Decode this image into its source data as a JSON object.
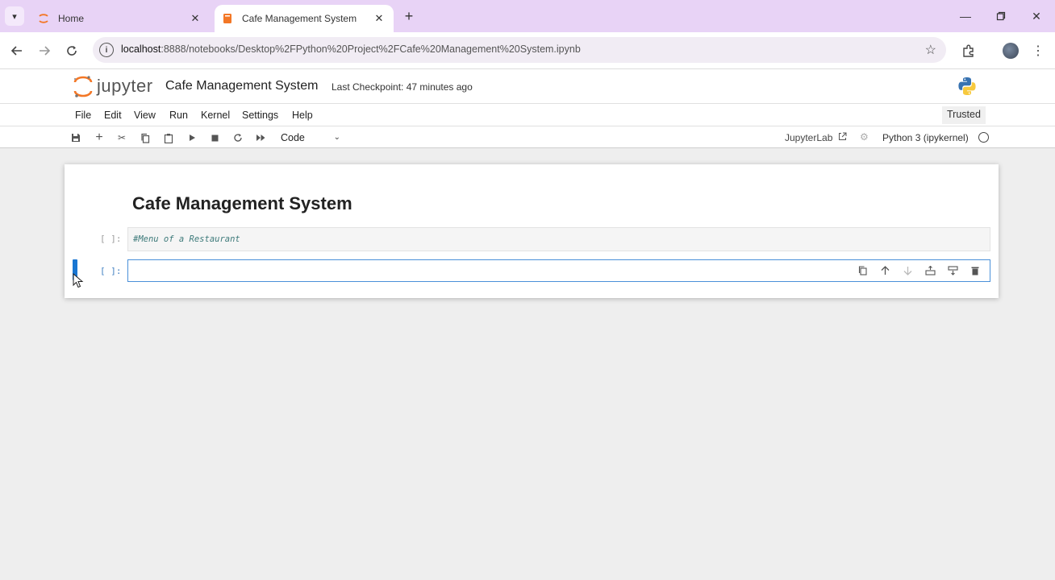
{
  "browser": {
    "tabs": [
      {
        "label": "Home",
        "icon": "jupyter-favicon",
        "active": false
      },
      {
        "label": "Cafe Management System",
        "icon": "notebook-favicon",
        "active": true
      }
    ],
    "new_tab": "+",
    "url_host": "localhost",
    "url_rest": ":8888/notebooks/Desktop%2FPython%20Project%2FCafe%20Management%20System.ipynb"
  },
  "jupyter": {
    "logo_text": "jupyter",
    "notebook_title": "Cafe Management System",
    "checkpoint": "Last Checkpoint: 47 minutes ago"
  },
  "menu": {
    "items": [
      "File",
      "Edit",
      "View",
      "Run",
      "Kernel",
      "Settings",
      "Help"
    ],
    "trusted": "Trusted"
  },
  "toolbar": {
    "cell_type": "Code",
    "jupyterlab_link": "JupyterLab",
    "kernel": "Python 3 (ipykernel)"
  },
  "notebook": {
    "heading": "Cafe Management System",
    "cells": [
      {
        "prompt": "[ ]:",
        "source": "#Menu of a Restaurant"
      },
      {
        "prompt": "[ ]:",
        "source": ""
      }
    ]
  },
  "colors": {
    "tabstrip": "#e8d3f6",
    "accent_blue": "#1976d2",
    "jupyter_orange": "#f37726",
    "comment_teal": "#3d7a7a"
  }
}
